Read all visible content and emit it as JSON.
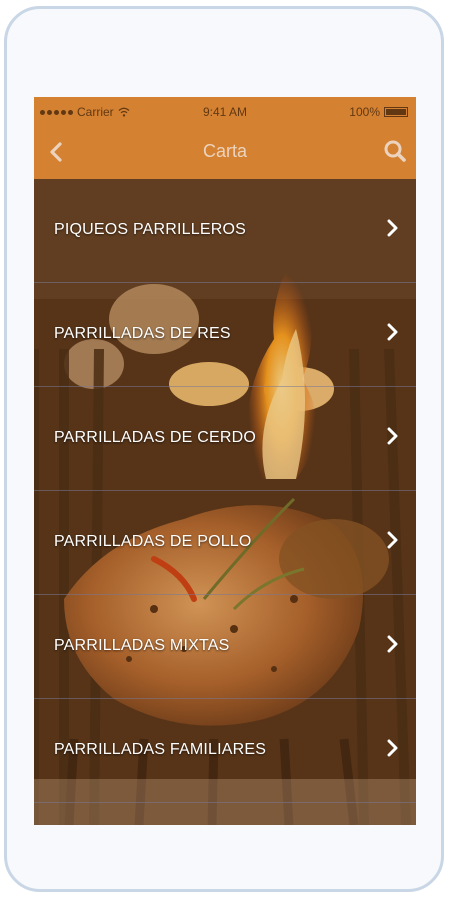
{
  "status_bar": {
    "carrier": "Carrier",
    "time": "9:41 AM",
    "battery": "100%"
  },
  "nav": {
    "title": "Carta"
  },
  "menu": {
    "items": [
      {
        "label": "PIQUEOS PARRILLEROS"
      },
      {
        "label": "PARRILLADAS DE RES"
      },
      {
        "label": "PARRILLADAS DE CERDO"
      },
      {
        "label": "PARRILLADAS DE POLLO"
      },
      {
        "label": "PARRILLADAS MIXTAS"
      },
      {
        "label": "PARRILLADAS FAMILIARES"
      }
    ]
  },
  "colors": {
    "accent": "#df8a37",
    "text": "#ffffff"
  },
  "icons": [
    "signal-icon",
    "wifi-icon",
    "battery-icon",
    "back-arrow-icon",
    "search-icon",
    "chevron-right-icon"
  ]
}
